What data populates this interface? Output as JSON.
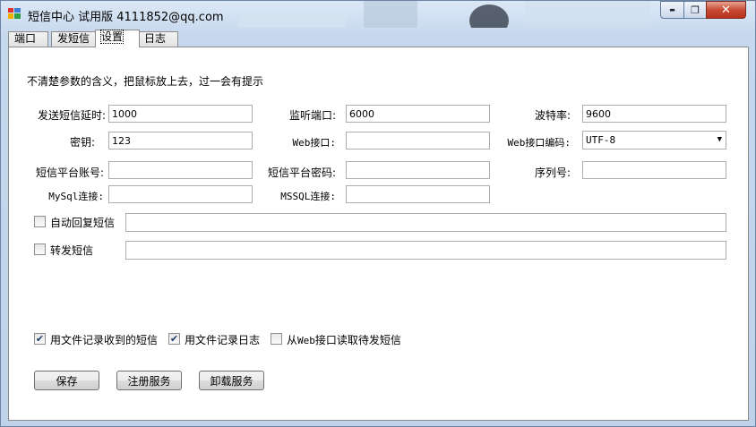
{
  "window": {
    "title": "短信中心 试用版 4111852@qq.com",
    "controls": {
      "minimize": "▬",
      "maximize": "❐",
      "close": "✕"
    }
  },
  "tabs": [
    {
      "label": "端口",
      "active": false
    },
    {
      "label": "发短信",
      "active": false
    },
    {
      "label": "设置",
      "active": true
    },
    {
      "label": "日志",
      "active": false
    }
  ],
  "settings": {
    "hint": "不清楚参数的含义，把鼠标放上去，过一会有提示",
    "send_delay_label": "发送短信延时:",
    "send_delay_value": "1000",
    "listen_port_label": "监听端口:",
    "listen_port_value": "6000",
    "baud_rate_label": "波特率:",
    "baud_rate_value": "9600",
    "key_label": "密钥:",
    "key_value": "123",
    "web_port_label": "Web接口:",
    "web_port_value": "",
    "web_encoding_label": "Web接口编码:",
    "web_encoding_value": "UTF-8",
    "platform_account_label": "短信平台账号:",
    "platform_account_value": "",
    "platform_password_label": "短信平台密码:",
    "platform_password_value": "",
    "serial_label": "序列号:",
    "serial_value": "",
    "mysql_label": "MySql连接:",
    "mysql_value": "",
    "mssql_label": "MSSQL连接:",
    "mssql_value": "",
    "auto_reply_label": "自动回复短信",
    "auto_reply_checked": false,
    "auto_reply_value": "",
    "forward_label": "转发短信",
    "forward_checked": false,
    "forward_value": "",
    "log_received_label": "用文件记录收到的短信",
    "log_received_checked": true,
    "log_file_label": "用文件记录日志",
    "log_file_checked": true,
    "read_web_prefix": "从",
    "read_web_mono": "Web",
    "read_web_suffix": "接口读取待发短信",
    "read_web_checked": false,
    "check_mark": "✔"
  },
  "buttons": {
    "save": "保存",
    "register": "注册服务",
    "uninstall": "卸载服务"
  },
  "colors": {
    "frame": "#c6d8ee",
    "close_button": "#c84b33",
    "panel": "#ffffff"
  }
}
